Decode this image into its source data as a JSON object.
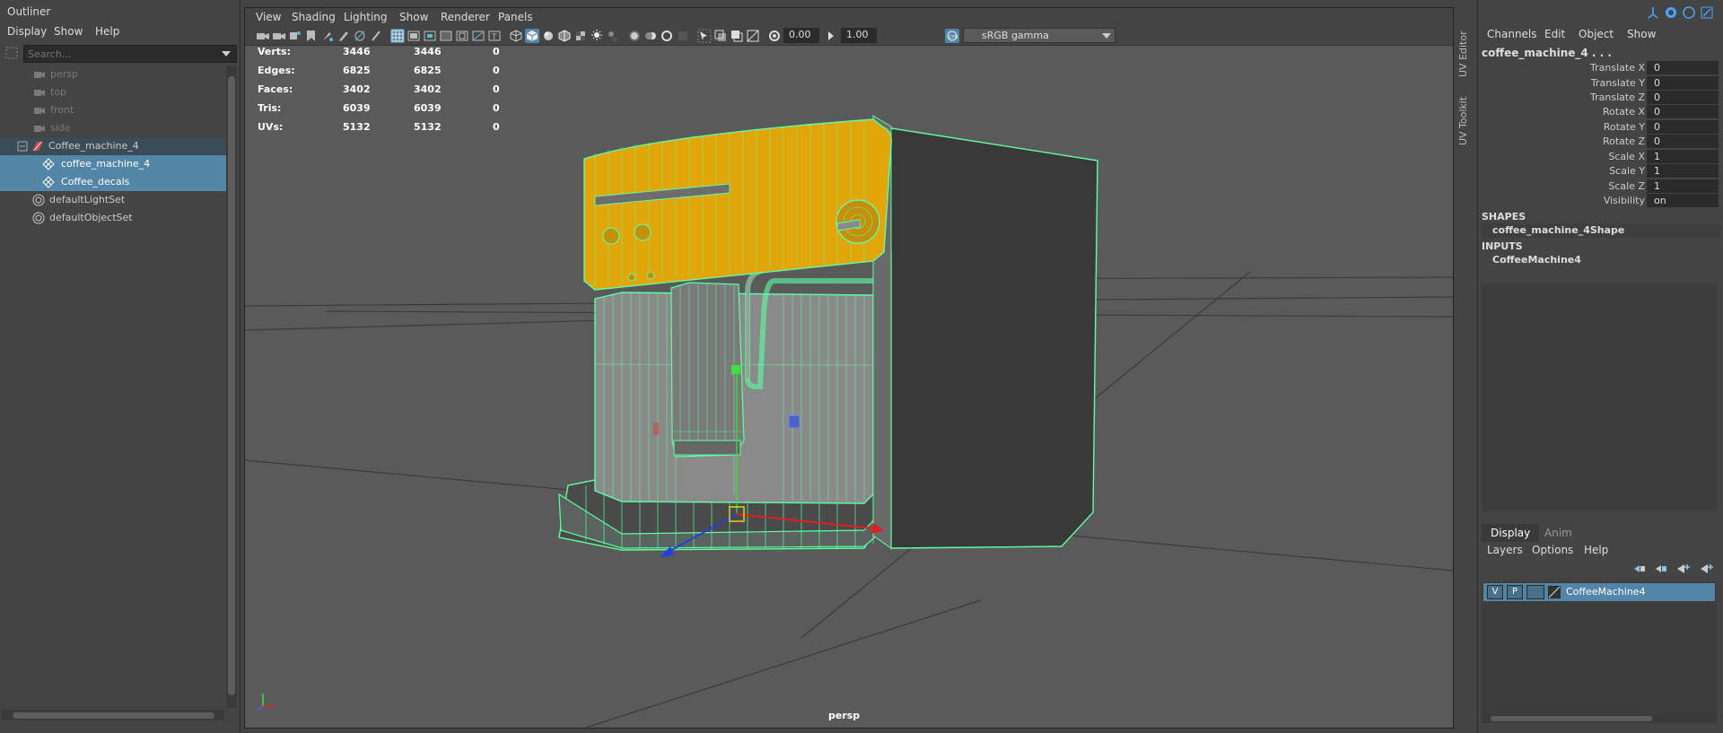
{
  "outliner": {
    "title": "Outliner",
    "menu": [
      "Display",
      "Show",
      "Help"
    ],
    "search_placeholder": "Search...",
    "items": [
      {
        "label": "persp",
        "icon": "camera-icon"
      },
      {
        "label": "top",
        "icon": "camera-icon"
      },
      {
        "label": "front",
        "icon": "camera-icon"
      },
      {
        "label": "side",
        "icon": "camera-icon"
      },
      {
        "label": "Coffee_machine_4",
        "icon": "group-icon"
      },
      {
        "label": "coffee_machine_4",
        "icon": "mesh-icon"
      },
      {
        "label": "Coffee_decals",
        "icon": "mesh-icon"
      },
      {
        "label": "defaultLightSet",
        "icon": "set-icon"
      },
      {
        "label": "defaultObjectSet",
        "icon": "set-icon"
      }
    ]
  },
  "viewport": {
    "menu": [
      "View",
      "Shading",
      "Lighting",
      "Show",
      "Renderer",
      "Panels"
    ],
    "exposure": "0.00",
    "gamma": "1.00",
    "color_space": "sRGB gamma",
    "hud": [
      {
        "label": "Verts:",
        "a": "3446",
        "b": "3446",
        "c": "0"
      },
      {
        "label": "Edges:",
        "a": "6825",
        "b": "6825",
        "c": "0"
      },
      {
        "label": "Faces:",
        "a": "3402",
        "b": "3402",
        "c": "0"
      },
      {
        "label": "Tris:",
        "a": "6039",
        "b": "6039",
        "c": "0"
      },
      {
        "label": "UVs:",
        "a": "5132",
        "b": "5132",
        "c": "0"
      }
    ],
    "camera": "persp"
  },
  "side_tabs": [
    "UV Editor",
    "UV Toolkit"
  ],
  "channel_box": {
    "menu": [
      "Channels",
      "Edit",
      "Object",
      "Show"
    ],
    "object": "coffee_machine_4 . . .",
    "attributes": [
      {
        "name": "Translate X",
        "value": "0"
      },
      {
        "name": "Translate Y",
        "value": "0"
      },
      {
        "name": "Translate Z",
        "value": "0"
      },
      {
        "name": "Rotate X",
        "value": "0"
      },
      {
        "name": "Rotate Y",
        "value": "0"
      },
      {
        "name": "Rotate Z",
        "value": "0"
      },
      {
        "name": "Scale X",
        "value": "1"
      },
      {
        "name": "Scale Y",
        "value": "1"
      },
      {
        "name": "Scale Z",
        "value": "1"
      },
      {
        "name": "Visibility",
        "value": "on"
      }
    ],
    "shapes_header": "SHAPES",
    "shape": "coffee_machine_4Shape",
    "inputs_header": "INPUTS",
    "input": "CoffeeMachine4"
  },
  "layer_editor": {
    "tabs": [
      "Display",
      "Anim"
    ],
    "menu": [
      "Layers",
      "Options",
      "Help"
    ],
    "layer": {
      "v": "V",
      "p": "P",
      "name": "CoffeeMachine4"
    }
  },
  "colors": {
    "selection": "#5285a6",
    "wire": "#5effa3",
    "panel_orange": "#e2a50a",
    "viewport_bg": "#5a5a5a"
  }
}
